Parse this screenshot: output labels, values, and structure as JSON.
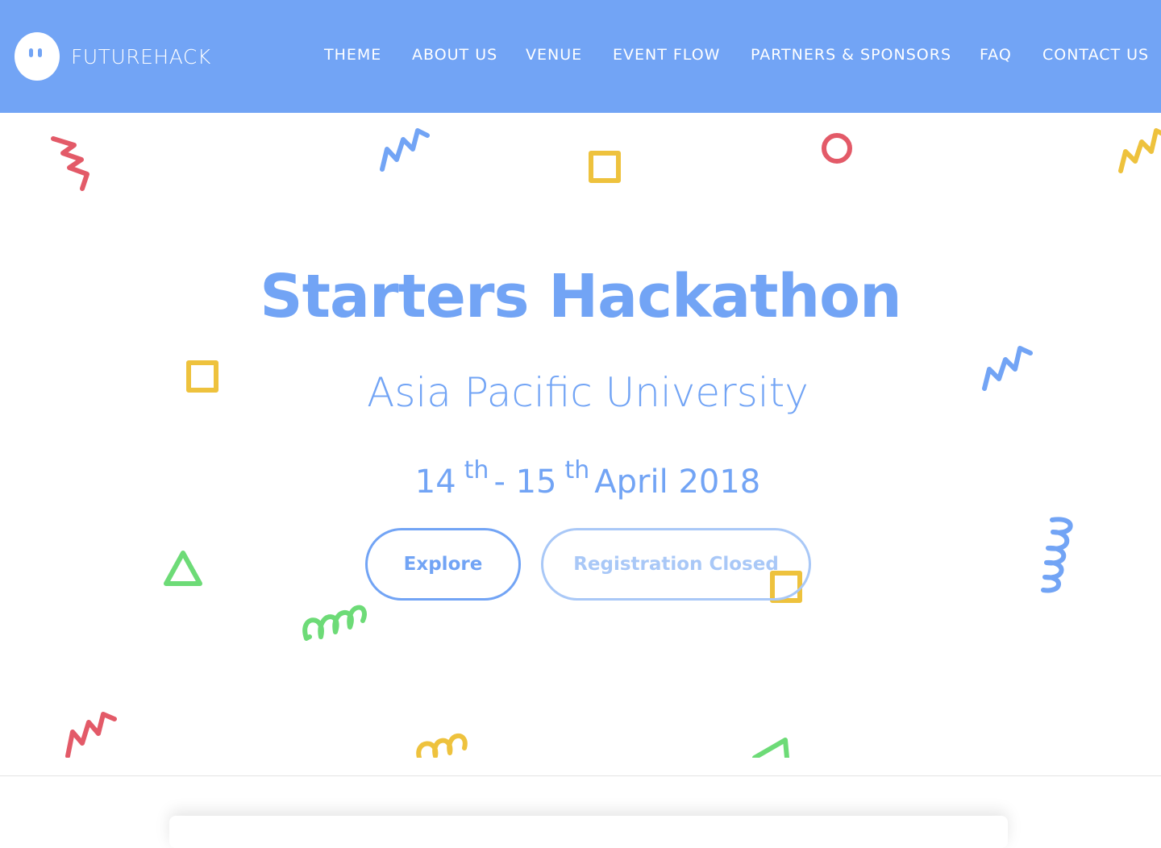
{
  "navbar": {
    "brand": "FUTUREHACK",
    "items": [
      {
        "label": "THEME"
      },
      {
        "label": "ABOUT US"
      },
      {
        "label": "VENUE"
      },
      {
        "label": "EVENT FLOW"
      },
      {
        "label": "PARTNERS & SPONSORS"
      },
      {
        "label": "FAQ"
      },
      {
        "label": "CONTACT US"
      }
    ]
  },
  "hero": {
    "title": "Starters Hackathon",
    "subtitle": "Asia Pacific University",
    "date": {
      "start_day": "14",
      "start_suffix": "th",
      "separator": "-",
      "end_day": "15",
      "end_suffix": "th",
      "month_year": "April 2018"
    },
    "buttons": {
      "explore": "Explore",
      "registration": "Registration Closed"
    }
  },
  "colors": {
    "primary": "#72a4f5",
    "red": "#e35a68",
    "yellow": "#eec23d",
    "green": "#6ddb77",
    "blue": "#72a4f5"
  },
  "icons": {
    "logo": "ghost-face-icon"
  }
}
